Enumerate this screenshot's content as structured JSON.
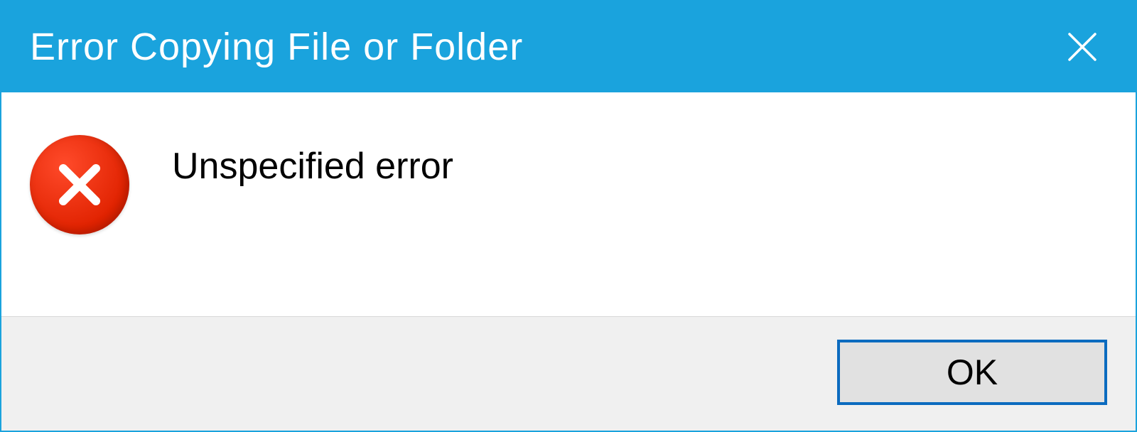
{
  "titlebar": {
    "title": "Error Copying File or Folder"
  },
  "content": {
    "message": "Unspecified error"
  },
  "buttons": {
    "ok_label": "OK"
  },
  "colors": {
    "accent": "#1aa3dd",
    "error_icon": "#e02200",
    "button_border": "#0b6bbf"
  }
}
